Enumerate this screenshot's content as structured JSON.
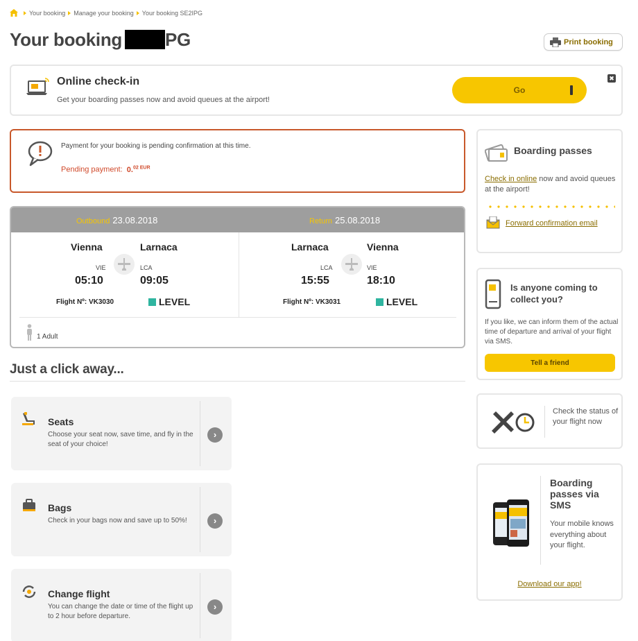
{
  "breadcrumb": {
    "items": [
      "Your booking",
      "Manage your booking",
      "Your booking SE2IPG"
    ]
  },
  "page": {
    "title_prefix": "Your booking",
    "title_suffix": "PG"
  },
  "print": {
    "label": "Print booking"
  },
  "checkin": {
    "title": "Online check-in",
    "subtitle": "Get your boarding passes now and avoid queues at the airport!",
    "go_label": "Go",
    "close_label": "✖"
  },
  "payment": {
    "message": "Payment for your booking is pending confirmation at this time.",
    "pending_label": "Pending payment:",
    "amount_main": "0.",
    "amount_decimals": "02",
    "currency": "EUR"
  },
  "flights": {
    "outbound": {
      "label": "Outbound",
      "date": "23.08.2018",
      "from_city": "Vienna",
      "to_city": "Larnaca",
      "from_code": "VIE",
      "to_code": "LCA",
      "dep_time": "05:10",
      "arr_time": "09:05",
      "flight_no": "Flight Nº: VK3030",
      "airline": "LEVEL"
    },
    "return": {
      "label": "Return",
      "date": "25.08.2018",
      "from_city": "Larnaca",
      "to_city": "Vienna",
      "from_code": "LCA",
      "to_code": "VIE",
      "dep_time": "15:55",
      "arr_time": "18:10",
      "flight_no": "Flight Nº: VK3031",
      "airline": "LEVEL"
    },
    "passengers": "1 Adult",
    "airline_color": "#2fb5a0"
  },
  "services": {
    "title": "Just a click away...",
    "items": [
      {
        "name": "Seats",
        "desc": "Choose your seat now, save time, and fly in the seat of your choice!"
      },
      {
        "name": "Bags",
        "desc": "Check in your bags now and save up to 50%!"
      },
      {
        "name": "Change flight",
        "desc": "You can change the date or time of the flight up to 2 hour before departure."
      }
    ]
  },
  "boarding": {
    "title": "Boarding passes",
    "link": "Check in online",
    "text": " now and avoid queues at the airport!",
    "forward": "Forward confirmation email"
  },
  "anyone": {
    "title": "Is anyone coming to collect you?",
    "text": "If you like, we can inform them of the actual time of departure and arrival of your flight via SMS.",
    "button": "Tell a friend"
  },
  "status": {
    "text": "Check the status of your flight now"
  },
  "sms": {
    "title": "Boarding passes via SMS",
    "text": "Your mobile knows everything about your flight.",
    "download": "Download our app!"
  },
  "colors": {
    "accent": "#f7c600",
    "alert": "#c8582a",
    "link": "#8a6d00"
  }
}
